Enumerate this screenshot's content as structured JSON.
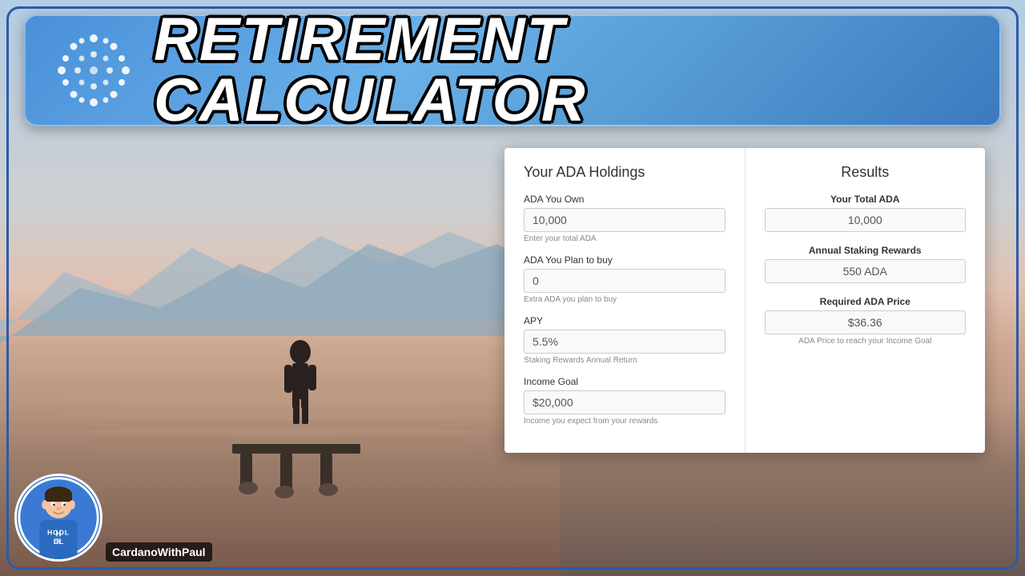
{
  "header": {
    "title": "RETIREMENT CALCULATOR",
    "logo_alt": "Cardano logo"
  },
  "calculator": {
    "left_section": {
      "title": "Your ADA Holdings",
      "fields": [
        {
          "label": "ADA You Own",
          "value": "10,000",
          "placeholder": "10,000",
          "hint": "Enter your total ADA"
        },
        {
          "label": "ADA You Plan to buy",
          "value": "0",
          "placeholder": "0",
          "hint": "Extra ADA you plan to buy"
        },
        {
          "label": "APY",
          "value": "5.5%",
          "placeholder": "5.5%",
          "hint": "Staking Rewards Annual Return"
        },
        {
          "label": "Income Goal",
          "value": "$20,000",
          "placeholder": "$20,000",
          "hint": "Income you expect from your rewards"
        }
      ]
    },
    "right_section": {
      "title": "Results",
      "results": [
        {
          "label": "Your Total ADA",
          "value": "10,000",
          "hint": ""
        },
        {
          "label": "Annual Staking Rewards",
          "value": "550 ADA",
          "hint": ""
        },
        {
          "label": "Required ADA Price",
          "value": "$36.36",
          "hint": "ADA Price to reach your Income Goal"
        }
      ]
    }
  },
  "branding": {
    "hodl_text": "HODL",
    "channel_name": "CardanoWithPaul"
  }
}
